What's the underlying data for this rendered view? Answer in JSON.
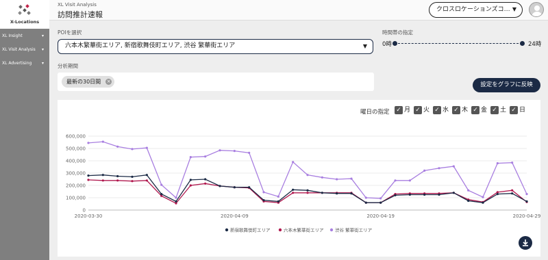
{
  "sidebar": {
    "logo_text": "X-Locations",
    "items": [
      {
        "label": "XL Insight"
      },
      {
        "label": "XL Visit Analysis"
      },
      {
        "label": "XL Advertising"
      }
    ]
  },
  "header": {
    "app_name": "XL Visit Analysis",
    "title": "訪問推計速報",
    "org_label": "クロスロケーションズコ…"
  },
  "controls": {
    "poi_label": "POIを選択",
    "poi_value": "六本木繁華街エリア, 新宿歌舞伎町エリア, 渋谷 繁華街エリア",
    "period_label": "分析期間",
    "period_chip": "最新の30日間",
    "time_label": "時間帯の指定",
    "time_min": "0時",
    "time_max": "24時",
    "apply_label": "設定をグラフに反映"
  },
  "weekday": {
    "label": "曜日の指定",
    "days": [
      "月",
      "火",
      "水",
      "木",
      "金",
      "土",
      "日"
    ]
  },
  "colors": {
    "primary": "#1b2a45",
    "series_shinjuku": "#1b2a45",
    "series_roppongi": "#b0184e",
    "series_shibuya": "#a87ee0"
  },
  "chart_data": {
    "type": "line",
    "x": [
      "2020-03-30",
      "2020-03-31",
      "2020-04-01",
      "2020-04-02",
      "2020-04-03",
      "2020-04-04",
      "2020-04-05",
      "2020-04-06",
      "2020-04-07",
      "2020-04-08",
      "2020-04-09",
      "2020-04-10",
      "2020-04-11",
      "2020-04-12",
      "2020-04-13",
      "2020-04-14",
      "2020-04-15",
      "2020-04-16",
      "2020-04-17",
      "2020-04-18",
      "2020-04-19",
      "2020-04-20",
      "2020-04-21",
      "2020-04-22",
      "2020-04-23",
      "2020-04-24",
      "2020-04-25",
      "2020-04-26",
      "2020-04-27",
      "2020-04-28",
      "2020-04-29"
    ],
    "x_ticks": [
      "2020-03-30",
      "2020-04-09",
      "2020-04-19",
      "2020-04-29"
    ],
    "y_ticks": [
      0,
      100000,
      200000,
      300000,
      400000,
      500000,
      600000
    ],
    "y_tick_labels": [
      "0",
      "100,000",
      "200,000",
      "300,000",
      "400,000",
      "500,000",
      "600,000"
    ],
    "ylim": [
      0,
      600000
    ],
    "series": [
      {
        "name": "新宿歌舞伎町エリア",
        "values": [
          280000,
          285000,
          275000,
          270000,
          285000,
          130000,
          70000,
          245000,
          250000,
          195000,
          185000,
          185000,
          80000,
          70000,
          165000,
          160000,
          140000,
          135000,
          135000,
          60000,
          60000,
          120000,
          125000,
          125000,
          125000,
          140000,
          75000,
          60000,
          130000,
          135000,
          70000
        ]
      },
      {
        "name": "六本木繁華街エリア",
        "values": [
          245000,
          240000,
          240000,
          235000,
          240000,
          115000,
          55000,
          200000,
          215000,
          195000,
          185000,
          180000,
          70000,
          60000,
          140000,
          140000,
          140000,
          140000,
          140000,
          60000,
          60000,
          130000,
          135000,
          135000,
          135000,
          140000,
          85000,
          65000,
          145000,
          160000,
          65000
        ]
      },
      {
        "name": "渋谷 繁華街エリア",
        "values": [
          545000,
          555000,
          515000,
          495000,
          505000,
          205000,
          100000,
          430000,
          435000,
          485000,
          480000,
          465000,
          145000,
          110000,
          390000,
          285000,
          265000,
          250000,
          255000,
          100000,
          95000,
          240000,
          240000,
          320000,
          340000,
          355000,
          160000,
          105000,
          380000,
          385000,
          130000
        ]
      }
    ]
  }
}
